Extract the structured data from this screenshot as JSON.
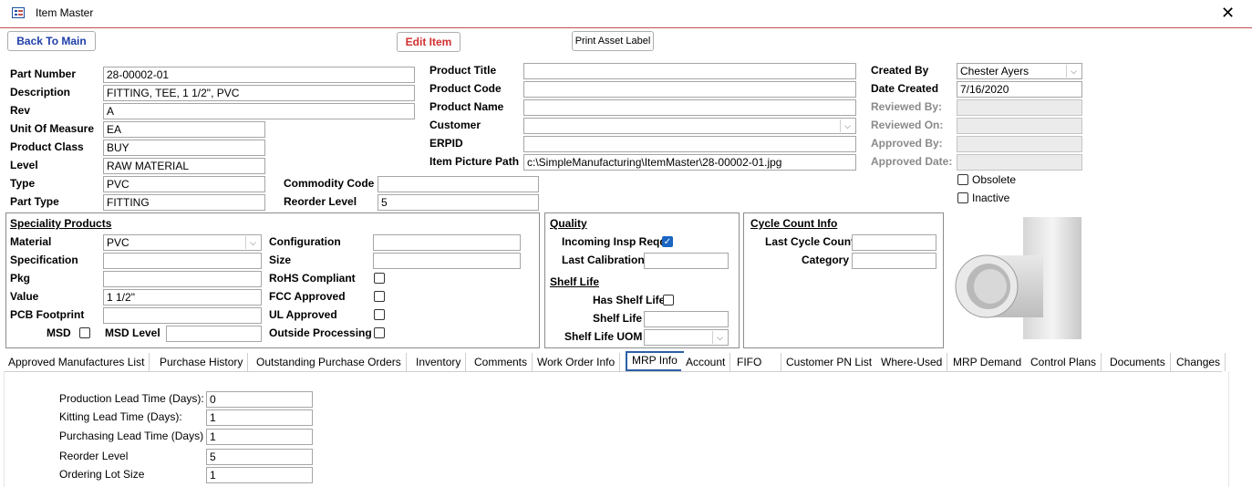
{
  "window": {
    "title": "Item Master"
  },
  "toolbar": {
    "back_label": "Back To Main",
    "edit_label": "Edit Item",
    "print_label": "Print Asset Label"
  },
  "part": {
    "part_number_label": "Part Number",
    "part_number": "28-00002-01",
    "description_label": "Description",
    "description": "FITTING, TEE, 1 1/2\", PVC",
    "rev_label": "Rev",
    "rev": "A",
    "uom_label": "Unit Of Measure",
    "uom": "EA",
    "product_class_label": "Product Class",
    "product_class": "BUY",
    "level_label": "Level",
    "level": "RAW MATERIAL",
    "type_label": "Type",
    "type": "PVC",
    "part_type_label": "Part Type",
    "part_type": "FITTING",
    "commodity_code_label": "Commodity Code",
    "commodity_code": "",
    "reorder_level_label": "Reorder Level",
    "reorder_level": "5"
  },
  "product": {
    "title_label": "Product Title",
    "title": "",
    "code_label": "Product Code",
    "code": "",
    "name_label": "Product Name",
    "name": "",
    "customer_label": "Customer",
    "customer": "",
    "erpid_label": "ERPID",
    "erpid": "",
    "picture_path_label": "Item Picture Path",
    "picture_path": "c:\\SimpleManufacturing\\ItemMaster\\28-00002-01.jpg"
  },
  "audit": {
    "created_by_label": "Created By",
    "created_by": "Chester Ayers",
    "date_created_label": "Date Created",
    "date_created": "7/16/2020",
    "reviewed_by_label": "Reviewed By:",
    "reviewed_on_label": "Reviewed On:",
    "approved_by_label": "Approved By:",
    "approved_date_label": "Approved Date:",
    "obsolete_label": "Obsolete",
    "obsolete": false,
    "inactive_label": "Inactive",
    "inactive": false
  },
  "speciality": {
    "heading": "Speciality Products",
    "material_label": "Material",
    "material": "PVC",
    "specification_label": "Specification",
    "specification": "",
    "pkg_label": "Pkg",
    "pkg": "",
    "value_label": "Value",
    "value": "1 1/2\"",
    "pcb_label": "PCB Footprint",
    "pcb": "",
    "msd_label": "MSD",
    "msd_level_label": "MSD Level",
    "msd_level": "",
    "configuration_label": "Configuration",
    "configuration": "",
    "size_label": "Size",
    "size": "",
    "rohs_label": "RoHS Compliant",
    "fcc_label": "FCC Approved",
    "ul_label": "UL Approved",
    "outside_label": "Outside Processing"
  },
  "quality": {
    "heading": "Quality",
    "incoming_label": "Incoming Insp Reqd",
    "incoming": true,
    "last_cal_label": "Last Calibration",
    "last_cal": "",
    "shelf_heading": "Shelf Life",
    "has_shelf_label": "Has Shelf Life",
    "has_shelf": false,
    "shelf_life_label": "Shelf Life",
    "shelf_life": "",
    "shelf_uom_label": "Shelf Life UOM",
    "shelf_uom": ""
  },
  "cycle": {
    "heading": "Cycle Count Info",
    "last_count_label": "Last Cycle Count",
    "last_count": "",
    "category_label": "Category",
    "category": ""
  },
  "tabs": [
    "Approved Manufactures List",
    "Purchase History",
    "Outstanding Purchase Orders",
    "Inventory",
    "Comments",
    "Work Order Info",
    "MRP Info",
    "Account",
    "FIFO",
    "Customer PN List",
    "Where-Used",
    "MRP Demand",
    "Control Plans",
    "Documents",
    "Changes"
  ],
  "active_tab": "MRP Info",
  "mrp": {
    "prod_lead_label": "Production Lead Time (Days):",
    "prod_lead": "0",
    "kit_lead_label": "Kitting Lead Time (Days):",
    "kit_lead": "1",
    "purch_lead_label": "Purchasing Lead Time (Days)",
    "purch_lead": "1",
    "reorder_label": "Reorder Level",
    "reorder": "5",
    "lot_label": "Ordering Lot Size",
    "lot": "1"
  },
  "colors": {
    "accent": "#1a66c2",
    "edit_red": "#d32f2f",
    "back_blue": "#1f3fa8",
    "title_rule": "#c0504d"
  },
  "icons": {
    "app": "form-icon",
    "close": "close-icon",
    "dropdown": "chevron-down-icon"
  }
}
